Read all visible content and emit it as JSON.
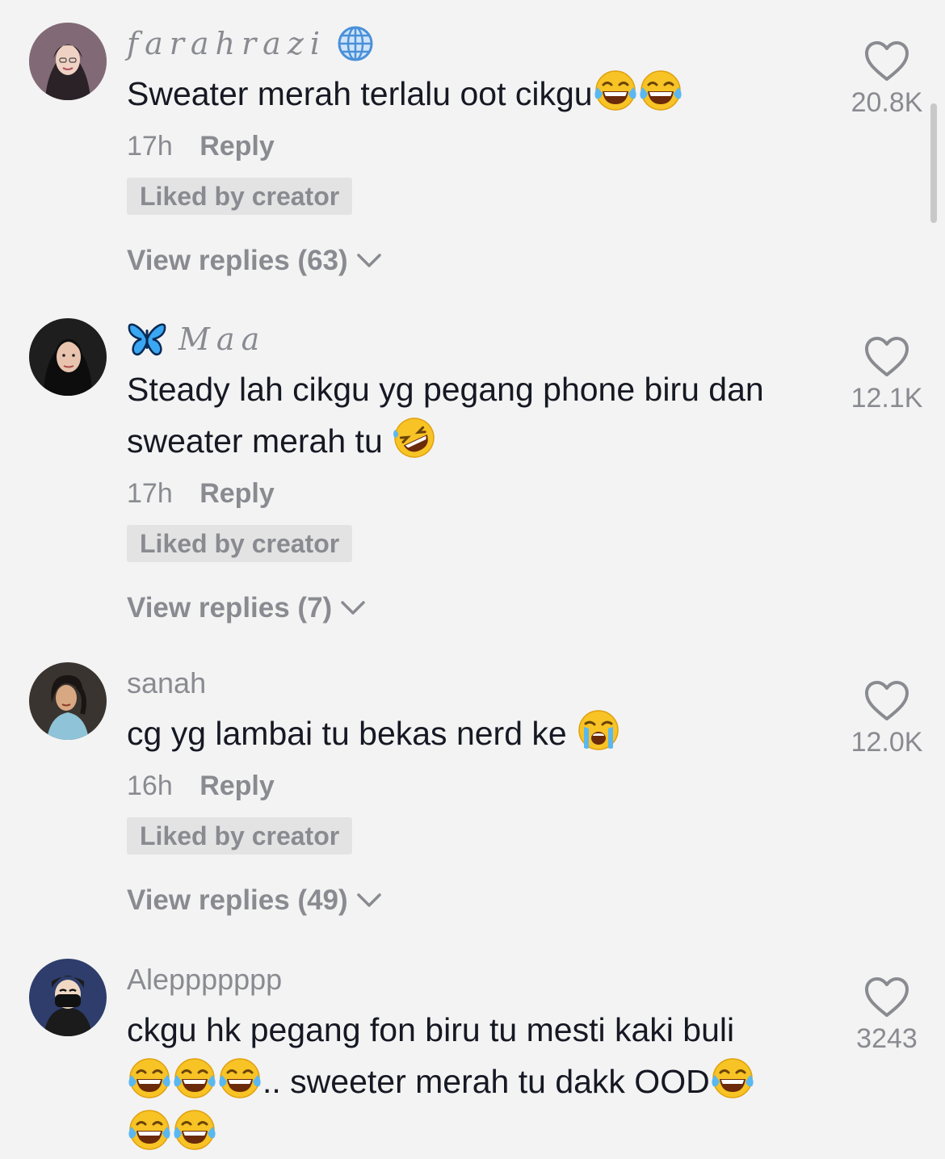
{
  "comments": [
    {
      "username": "farahrazi",
      "text_parts": [
        "Sweater merah terlalu oot cikgu"
      ],
      "time": "17h",
      "reply_label": "Reply",
      "liked_label": "Liked by creator",
      "view_replies": "View replies (63)",
      "likes": "20.8K"
    },
    {
      "username": "Maa",
      "text_parts": [
        "Steady lah cikgu yg pegang phone biru dan sweater merah tu "
      ],
      "time": "17h",
      "reply_label": "Reply",
      "liked_label": "Liked by creator",
      "view_replies": "View replies (7)",
      "likes": "12.1K"
    },
    {
      "username": "sanah",
      "text_parts": [
        "cg yg lambai tu bekas nerd ke "
      ],
      "time": "16h",
      "reply_label": "Reply",
      "liked_label": "Liked by creator",
      "view_replies": "View replies (49)",
      "likes": "12.0K"
    },
    {
      "username": "Aleppppppp",
      "text_parts": [
        "ckgu hk pegang fon biru tu mesti kaki buli",
        ".. sweeter merah tu dakk OOD"
      ],
      "likes": "3243"
    }
  ],
  "icons": {
    "heart": "heart-outline-icon",
    "chevron": "chevron-down-icon",
    "globe": "globe-icon",
    "butterfly": "blue-butterfly-icon",
    "tears_of_joy": "face-with-tears-of-joy-emoji",
    "rofl": "rolling-on-floor-laughing-emoji",
    "crying": "loudly-crying-face-emoji"
  },
  "colors": {
    "background": "#f3f3f3",
    "text": "#161823",
    "secondary": "#8a8b91",
    "badge_bg": "#e3e3e4"
  }
}
